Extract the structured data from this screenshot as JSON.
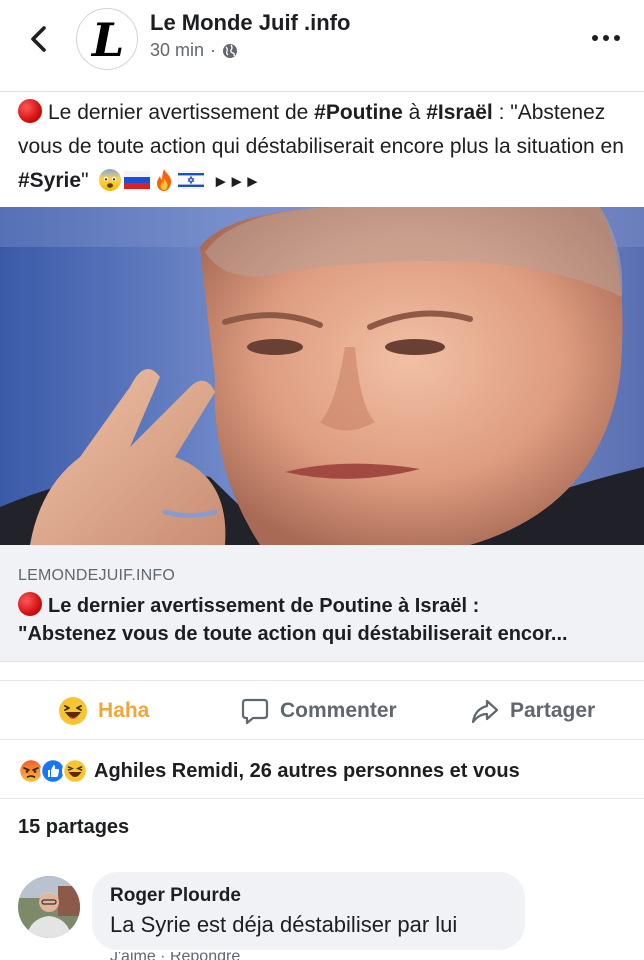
{
  "header": {
    "page_name": "Le Monde Juif .info",
    "time": "30 min",
    "separator": "·",
    "avatar_letter": "L"
  },
  "post": {
    "text_prefix": "Le dernier avertissement de ",
    "tag_poutine": "#Poutine",
    "text_mid1": " à ",
    "tag_israel": "#Israël",
    "text_mid2": " : \"Abstenez vous de toute action qui déstabiliserait encore plus la situation en ",
    "tag_syrie": "#Syrie",
    "text_suffix": "\"",
    "trailing_arrows": "►►►",
    "emoji_icons": [
      "fearful-face-icon",
      "russia-flag-icon",
      "fire-icon",
      "israel-flag-icon"
    ]
  },
  "link": {
    "domain": "LEMONDEJUIF.INFO",
    "title_line1": "Le dernier avertissement de Poutine à Israël :",
    "title_line2": "\"Abstenez vous de toute action qui déstabiliserait encor..."
  },
  "actions": {
    "haha_label": "Haha",
    "comment_label": "Commenter",
    "share_label": "Partager"
  },
  "reactions": {
    "icons": [
      "angry-icon",
      "like-icon",
      "haha-icon"
    ],
    "summary": "Aghiles Remidi, 26 autres personnes et vous"
  },
  "shares": "15 partages",
  "comment": {
    "author": "Roger Plourde",
    "text": "La Syrie est déja déstabiliser par lui",
    "footer": "J'aime · Répondre"
  },
  "colors": {
    "haha_accent": "#f0a73a",
    "secondary_text": "#606770",
    "link_bg": "#f0f2f5",
    "like_blue": "#1877f2",
    "angry_orange": "#f05d2e"
  }
}
